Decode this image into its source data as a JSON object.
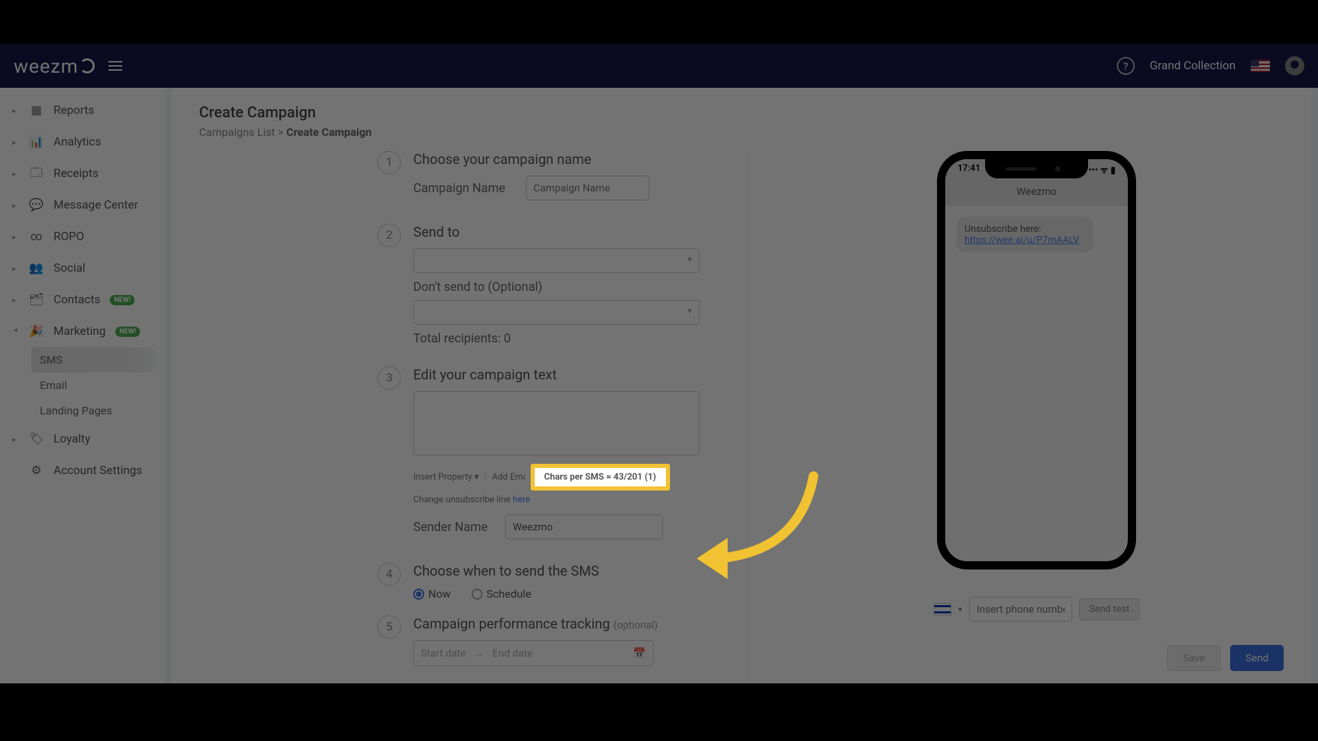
{
  "topbar": {
    "brand": "weezm",
    "account": "Grand Collection"
  },
  "sidebar": {
    "items": [
      {
        "label": "Reports"
      },
      {
        "label": "Analytics"
      },
      {
        "label": "Receipts"
      },
      {
        "label": "Message Center"
      },
      {
        "label": "ROPO"
      },
      {
        "label": "Social"
      },
      {
        "label": "Contacts",
        "badge": "NEW!"
      },
      {
        "label": "Marketing",
        "badge": "NEW!"
      },
      {
        "label": "Loyalty"
      },
      {
        "label": "Account Settings"
      }
    ],
    "marketing_sub": [
      {
        "label": "SMS"
      },
      {
        "label": "Email"
      },
      {
        "label": "Landing Pages"
      }
    ]
  },
  "page": {
    "title": "Create Campaign",
    "crumb_list": "Campaigns List",
    "crumb_sep": ">",
    "crumb_current": "Create Campaign"
  },
  "steps": {
    "s1": {
      "num": "1",
      "title": "Choose your campaign name",
      "field_label": "Campaign Name",
      "placeholder": "Campaign Name"
    },
    "s2": {
      "num": "2",
      "title": "Send to",
      "dont_label": "Don't send to (Optional)",
      "total_label": "Total recipients:",
      "total_value": "0"
    },
    "s3": {
      "num": "3",
      "title": "Edit your campaign text",
      "insert": "Insert Property",
      "add_emoji": "Add Emoji",
      "chars": "Chars per SMS = 43/201 (1)",
      "change_pre": "Change unsubscribe line ",
      "change_link": "here",
      "sender_label": "Sender Name",
      "sender_value": "Weezmo"
    },
    "s4": {
      "num": "4",
      "title": "Choose when to send the SMS",
      "opt_now": "Now",
      "opt_schedule": "Schedule"
    },
    "s5": {
      "num": "5",
      "title": "Campaign performance tracking ",
      "opt": "(optional)",
      "start": "Start date",
      "end": "End date"
    }
  },
  "phone": {
    "time": "17:41",
    "signal": "📶 📡 🔋",
    "title": "Weezmo",
    "msg_text": "Unsubscribe here:",
    "msg_link": "https://wee.ai/u/P7mAALV"
  },
  "test": {
    "placeholder": "Insert phone number",
    "btn": "Send test",
    "dial": "▾"
  },
  "actions": {
    "save": "Save",
    "send": "Send"
  }
}
